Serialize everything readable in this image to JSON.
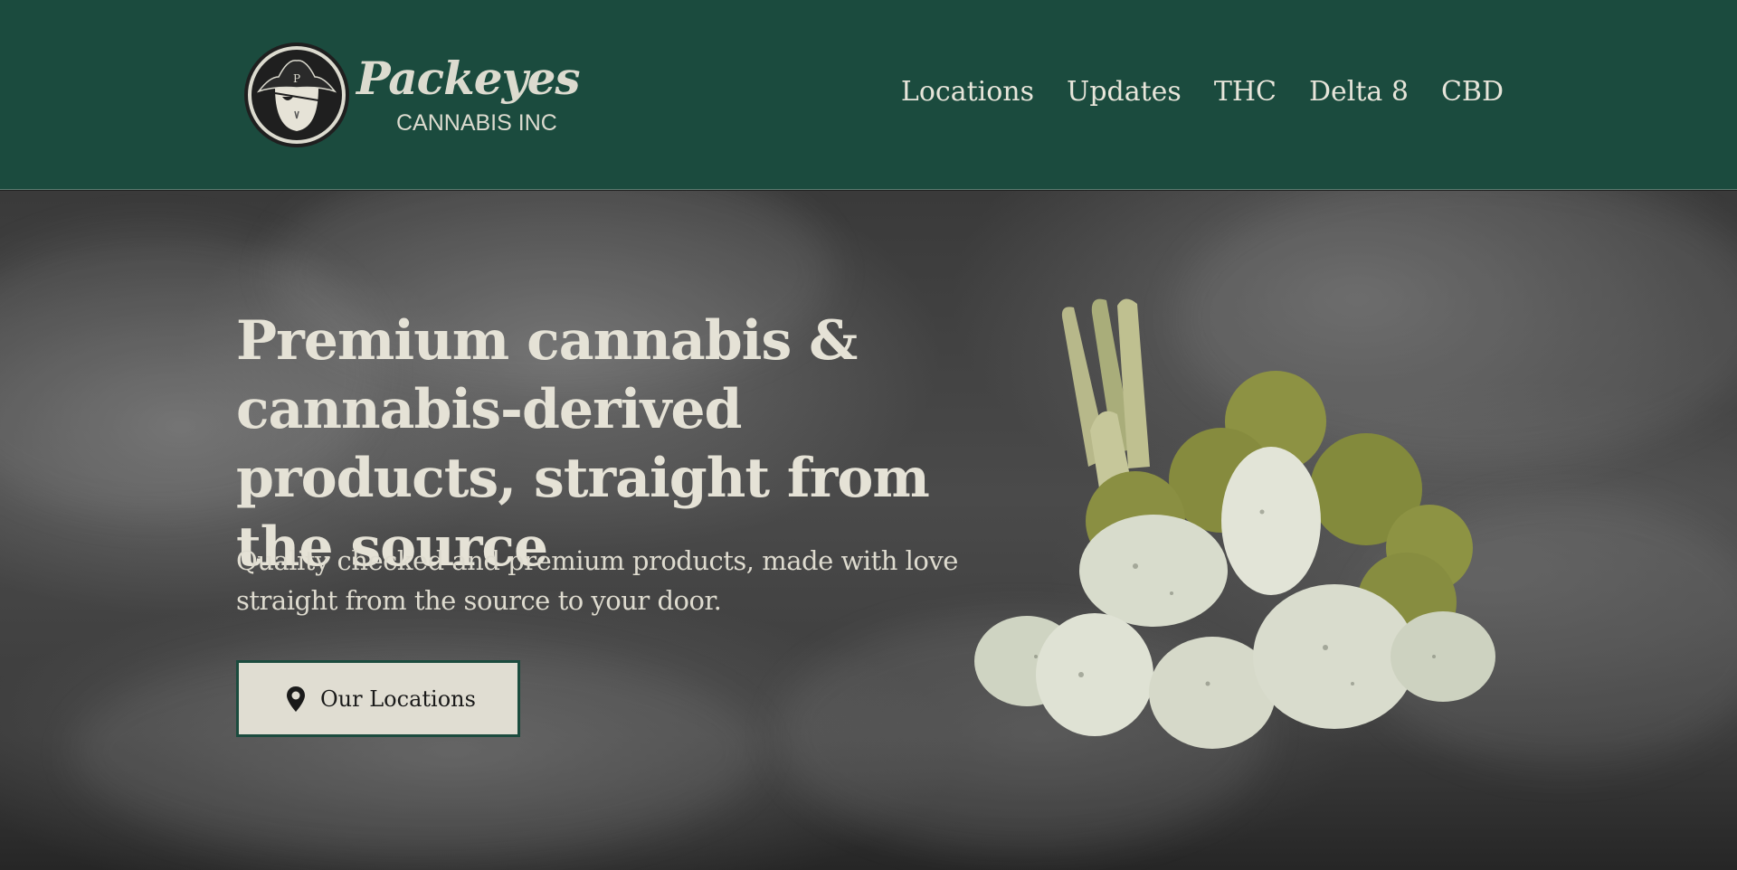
{
  "brand": {
    "name": "Packeyes",
    "subtitle": "CANNABIS INC",
    "badge_letter": "P",
    "color": "#1b4b3e"
  },
  "nav": {
    "items": [
      {
        "label": "Locations"
      },
      {
        "label": "Updates"
      },
      {
        "label": "THC"
      },
      {
        "label": "Delta 8"
      },
      {
        "label": "CBD"
      }
    ]
  },
  "hero": {
    "title": "Premium cannabis & cannabis-derived products, straight from the source",
    "subtitle": "Quality checked and premium products, made with love straight from the source to your door.",
    "cta": {
      "label": "Our Locations",
      "icon": "map-pin-icon"
    },
    "product_image": "moon-rocks-image"
  },
  "colors": {
    "header_bg": "#1b4b3e",
    "text_light": "#e5e2d6",
    "button_bg": "#e0ddd2"
  }
}
